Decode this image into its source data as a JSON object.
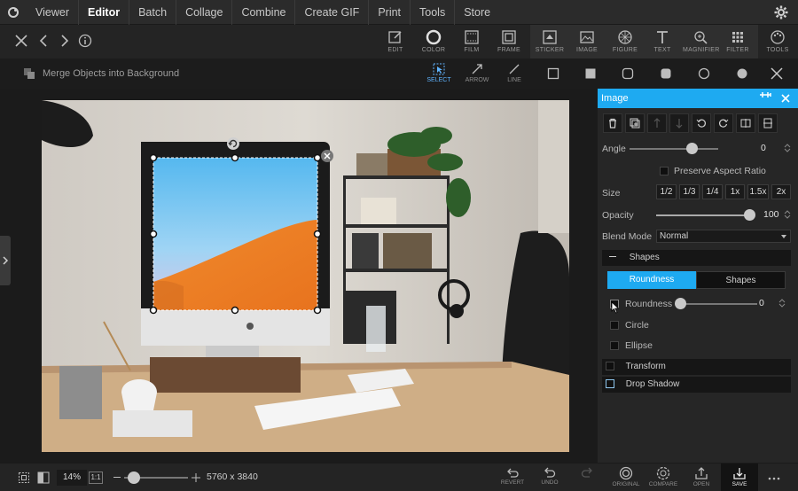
{
  "menu": {
    "items": [
      "Viewer",
      "Editor",
      "Batch",
      "Collage",
      "Combine",
      "Create GIF",
      "Print",
      "Tools",
      "Store"
    ],
    "active": "Editor"
  },
  "toolbar": {
    "tools": [
      "EDIT",
      "COLOR",
      "FILM",
      "FRAME",
      "STICKER",
      "IMAGE",
      "FIGURE",
      "TEXT",
      "MAGNIFIER",
      "FILTER",
      "TOOLS"
    ]
  },
  "subbar": {
    "merge_label": "Merge Objects into Background",
    "select_label": "SELECT",
    "arrow_label": "ARROW",
    "line_label": "LINE"
  },
  "panel": {
    "title": "Image",
    "angle_label": "Angle",
    "angle_value": "0",
    "preserve_label": "Preserve Aspect Ratio",
    "size_label": "Size",
    "size_options": [
      "1/2",
      "1/3",
      "1/4",
      "1x",
      "1.5x",
      "2x"
    ],
    "opacity_label": "Opacity",
    "opacity_value": "100",
    "blend_label": "Blend Mode",
    "blend_value": "Normal",
    "shapes_section": "Shapes",
    "tab_roundness": "Roundness",
    "tab_shapes": "Shapes",
    "roundness_label": "Roundness",
    "roundness_value": "0",
    "circle_label": "Circle",
    "ellipse_label": "Ellipse",
    "transform_label": "Transform",
    "dropshadow_label": "Drop Shadow",
    "accent": "#1eaaf1"
  },
  "bottom": {
    "zoom": "14%",
    "fit": "1:1",
    "dimensions": "5760 x 3840",
    "revert": "REVERT",
    "undo": "UNDO",
    "original": "ORIGINAL",
    "compare": "COMPARE",
    "open": "OPEN",
    "save": "SAVE"
  }
}
